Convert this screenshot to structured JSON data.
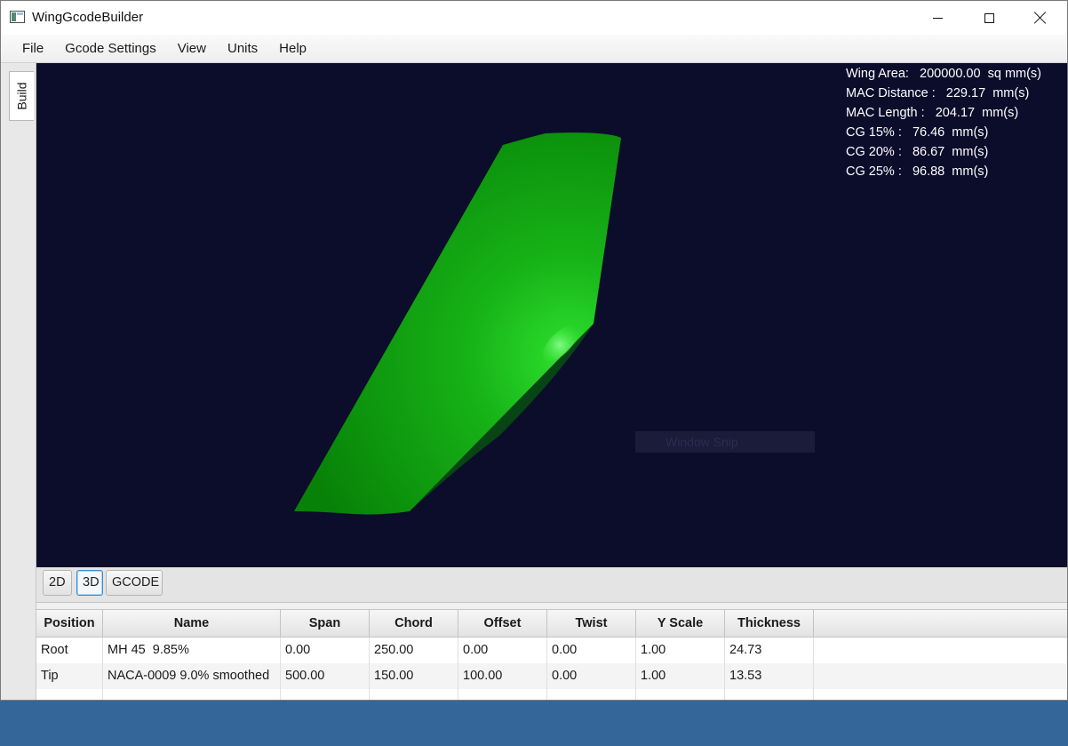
{
  "window": {
    "title": "WingGcodeBuilder",
    "controls": {
      "minimize": "minimize",
      "maximize": "maximize",
      "close": "close"
    }
  },
  "menu": [
    "File",
    "Gcode Settings",
    "View",
    "Units",
    "Help"
  ],
  "side_tab": {
    "label": "Build"
  },
  "viewport": {
    "background_color": "#0c0c2b",
    "wing_color": "#0a8a0a",
    "stats": [
      "Wing Area:   200000.00  sq mm(s)",
      "MAC Distance :   229.17  mm(s)",
      "MAC Length :   204.17  mm(s)",
      "CG 15% :   76.46  mm(s)",
      "CG 20% :   86.67  mm(s)",
      "CG 25% :   96.88  mm(s)"
    ],
    "overlay_text": "Window Snip"
  },
  "view_tabs": [
    {
      "label": "2D",
      "active": false
    },
    {
      "label": "3D",
      "active": true
    },
    {
      "label": "GCODE",
      "active": false
    }
  ],
  "table": {
    "columns": [
      "Position",
      "Name",
      "Span",
      "Chord",
      "Offset",
      "Twist",
      "Y Scale",
      "Thickness"
    ],
    "rows": [
      [
        "Root",
        "MH 45  9.85%",
        "0.00",
        "250.00",
        "0.00",
        "0.00",
        "1.00",
        "24.73"
      ],
      [
        "Tip",
        "NACA-0009 9.0% smoothed",
        "500.00",
        "150.00",
        "100.00",
        "0.00",
        "1.00",
        "13.53"
      ]
    ]
  },
  "taskbar": {
    "color": "#346699"
  }
}
